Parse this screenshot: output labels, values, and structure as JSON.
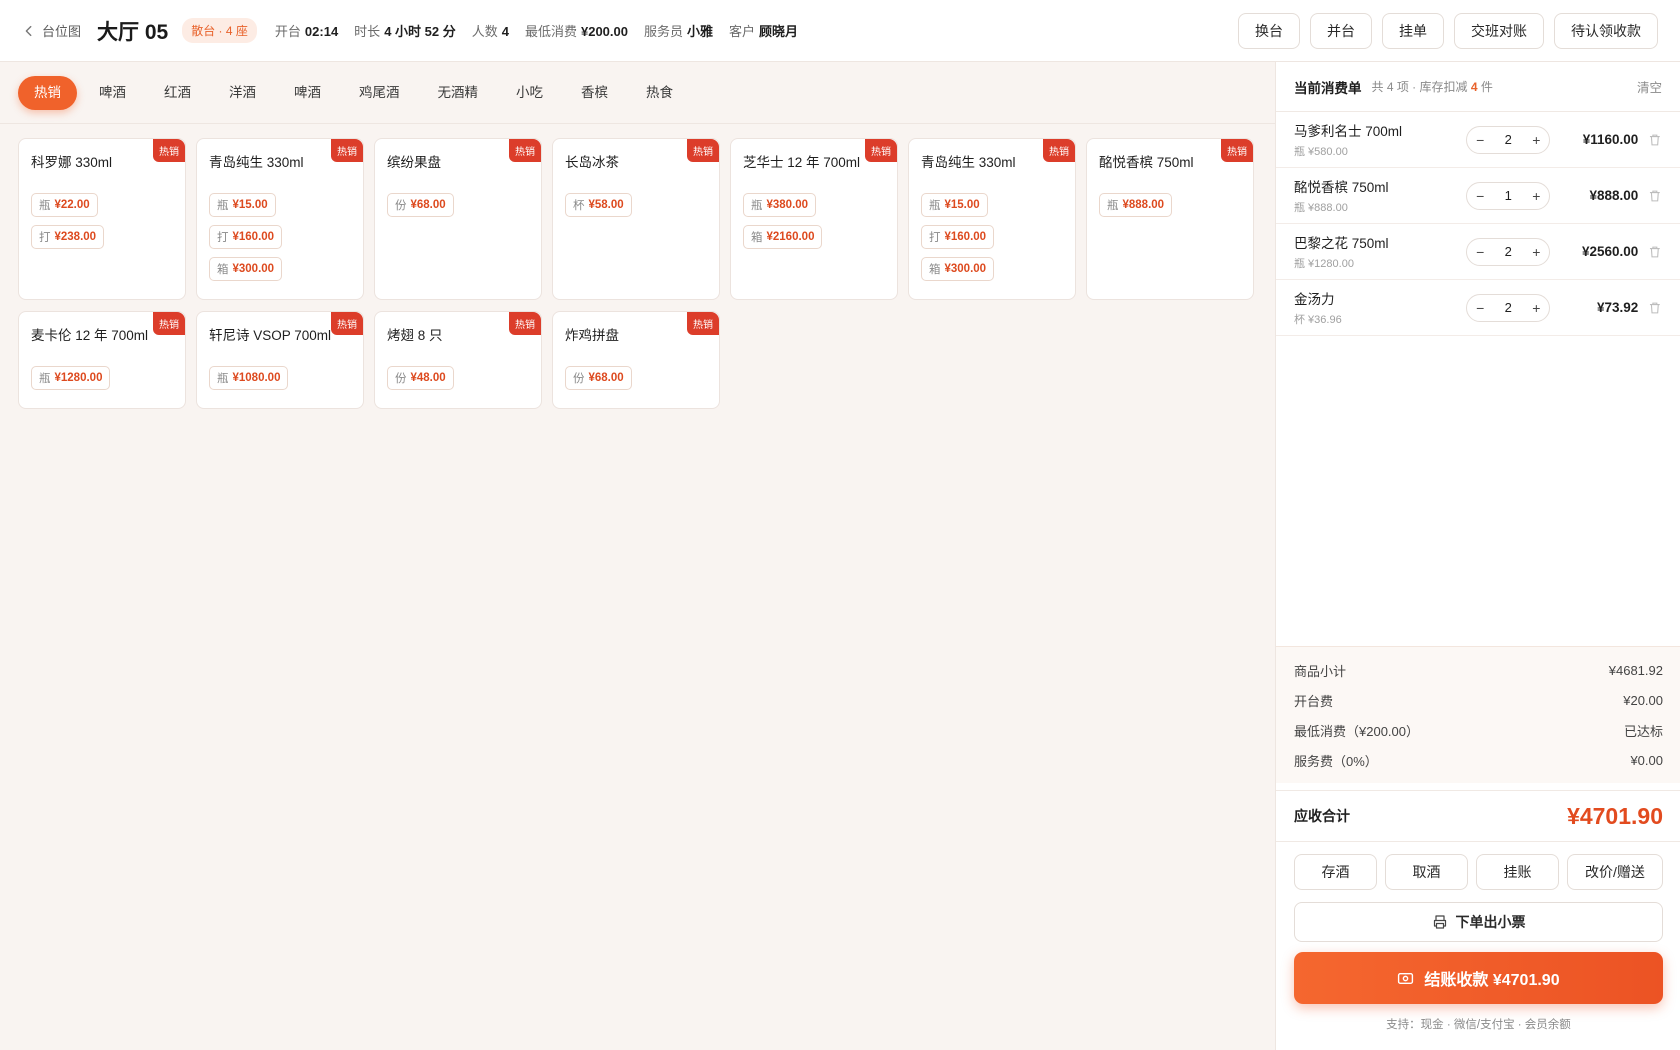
{
  "header": {
    "back_label": "台位图",
    "table_name": "大厅 05",
    "table_type": "散台 · 4 座",
    "meta": [
      {
        "label": "开台",
        "value": "02:14"
      },
      {
        "label": "时长",
        "value": "4 小时 52 分"
      },
      {
        "label": "人数",
        "value": "4"
      },
      {
        "label": "最低消费",
        "value": "¥200.00"
      },
      {
        "label": "服务员",
        "value": "小雅"
      },
      {
        "label": "客户",
        "value": "顾晓月"
      }
    ],
    "actions": [
      "换台",
      "并台",
      "挂单",
      "交班对账",
      "待认领收款"
    ]
  },
  "categories": [
    "热销",
    "啤酒",
    "红酒",
    "洋酒",
    "啤酒",
    "鸡尾酒",
    "无酒精",
    "小吃",
    "香槟",
    "热食"
  ],
  "hot_label": "热销",
  "products": [
    {
      "name": "科罗娜 330ml",
      "prices": [
        {
          "u": "瓶",
          "p": "¥22.00"
        },
        {
          "u": "打",
          "p": "¥238.00"
        }
      ]
    },
    {
      "name": "青岛纯生 330ml",
      "prices": [
        {
          "u": "瓶",
          "p": "¥15.00"
        },
        {
          "u": "打",
          "p": "¥160.00"
        },
        {
          "u": "箱",
          "p": "¥300.00"
        }
      ]
    },
    {
      "name": "缤纷果盘",
      "prices": [
        {
          "u": "份",
          "p": "¥68.00"
        }
      ]
    },
    {
      "name": "长岛冰茶",
      "prices": [
        {
          "u": "杯",
          "p": "¥58.00"
        }
      ]
    },
    {
      "name": "芝华士 12 年 700ml",
      "prices": [
        {
          "u": "瓶",
          "p": "¥380.00"
        },
        {
          "u": "箱",
          "p": "¥2160.00"
        }
      ]
    },
    {
      "name": "青岛纯生 330ml",
      "prices": [
        {
          "u": "瓶",
          "p": "¥15.00"
        },
        {
          "u": "打",
          "p": "¥160.00"
        },
        {
          "u": "箱",
          "p": "¥300.00"
        }
      ]
    },
    {
      "name": "酩悦香槟 750ml",
      "prices": [
        {
          "u": "瓶",
          "p": "¥888.00"
        }
      ]
    },
    {
      "name": "麦卡伦 12 年 700ml",
      "prices": [
        {
          "u": "瓶",
          "p": "¥1280.00"
        }
      ]
    },
    {
      "name": "轩尼诗 VSOP 700ml",
      "prices": [
        {
          "u": "瓶",
          "p": "¥1080.00"
        }
      ]
    },
    {
      "name": "烤翅 8 只",
      "prices": [
        {
          "u": "份",
          "p": "¥48.00"
        }
      ]
    },
    {
      "name": "炸鸡拼盘",
      "prices": [
        {
          "u": "份",
          "p": "¥68.00"
        }
      ]
    }
  ],
  "order": {
    "title": "当前消费单",
    "sub_prefix": "共 4 项 · 库存扣减",
    "sub_count": "4",
    "sub_suffix": "件",
    "clear_label": "清空",
    "items": [
      {
        "name": "马爹利名士 700ml",
        "unit": "瓶 ¥580.00",
        "qty": "2",
        "total": "¥1160.00"
      },
      {
        "name": "酩悦香槟 750ml",
        "unit": "瓶 ¥888.00",
        "qty": "1",
        "total": "¥888.00"
      },
      {
        "name": "巴黎之花 750ml",
        "unit": "瓶 ¥1280.00",
        "qty": "2",
        "total": "¥2560.00"
      },
      {
        "name": "金汤力",
        "unit": "杯 ¥36.96",
        "qty": "2",
        "total": "¥73.92"
      }
    ]
  },
  "summary": [
    {
      "label": "商品小计",
      "value": "¥4681.92"
    },
    {
      "label": "开台费",
      "value": "¥20.00"
    },
    {
      "label": "最低消费（¥200.00）",
      "value": "已达标"
    },
    {
      "label": "服务费（0%）",
      "value": "¥0.00"
    }
  ],
  "total": {
    "label": "应收合计",
    "value": "¥4701.90"
  },
  "bottom_actions": [
    "存酒",
    "取酒",
    "挂账",
    "改价/赠送"
  ],
  "print_label": "下单出小票",
  "pay_label": "结账收款 ¥4701.90",
  "support_text": "支持：现金 · 微信/支付宝 · 会员余额"
}
